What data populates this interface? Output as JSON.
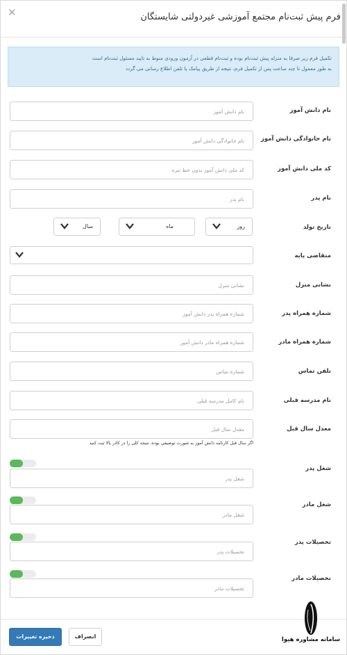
{
  "modal": {
    "title": "فرم پیش ثبت‌نام مجتمع آموزشی غیردولتی شایستگان",
    "close_icon": "close-icon"
  },
  "info": {
    "line1": "تکمیل فرم زیر صرفا به منزله پیش ثبت‌نام بوده و ثبت‌نام قطعی در آزمون ورودی منوط به تایید مسئول ثبت‌نام است",
    "line2": "به طور معمول تا چند ساعت پس از تکمیل فرم، نتیجه از طریق پیامک یا تلفن اطلاع رسانی می گردد"
  },
  "fields": {
    "first_name": {
      "label": "نام دانش آموز",
      "placeholder": "نام دانش آموز"
    },
    "last_name": {
      "label": "نام خانوادگی دانش آموز",
      "placeholder": "نام خانوادگی دانش آموز"
    },
    "national_code": {
      "label": "کد ملی دانش آموز",
      "placeholder": "کد ملی دانش آموز بدون خط تیره"
    },
    "father_name": {
      "label": "نام پدر",
      "placeholder": "نام پدر"
    },
    "birth_date": {
      "label": "تاریخ تولد",
      "day": "روز",
      "month": "ماه",
      "year": "سال"
    },
    "grade": {
      "label": "متقاضی پایه",
      "value": ""
    },
    "address": {
      "label": "نشانی منزل",
      "placeholder": "نشانی منزل"
    },
    "father_mobile": {
      "label": "شماره همراه پدر",
      "placeholder": "شماره همراه پدر دانش آموز"
    },
    "mother_mobile": {
      "label": "شماره همراه مادر",
      "placeholder": "شماره همراه مادر دانش آموز"
    },
    "phone": {
      "label": "تلفن تماس",
      "placeholder": "شماره تماس"
    },
    "previous_school": {
      "label": "نام مدرسه قبلی",
      "placeholder": "نام کامل مدرسه قبلی"
    },
    "previous_gpa": {
      "label": "معدل سال قبل",
      "placeholder": "معدل سال قبل"
    },
    "gpa_hint": "اگر سال قبل کارنامه دانش آموز به صورت توصیفی بوده، نتیجه کلی را در کادر بالا ثبت کنید",
    "father_job": {
      "label": "شغل پدر",
      "placeholder": "شغل پدر",
      "toggle_on": true
    },
    "mother_job": {
      "label": "شغل مادر",
      "placeholder": "شغل مادر",
      "toggle_on": true
    },
    "father_education": {
      "label": "تحصیلات پدر",
      "placeholder": "تحصیلات پدر",
      "toggle_on": true
    },
    "mother_education": {
      "label": "تحصیلات مادر",
      "placeholder": "تحصیلات مادر",
      "toggle_on": true
    }
  },
  "buttons": {
    "save": "ذخیره تغییرات",
    "cancel": "انصراف"
  },
  "watermark": {
    "text": "سامانه مشاوره هیوا"
  },
  "colors": {
    "primary": "#337ab7",
    "toggle_on": "#5cb85c",
    "info_bg": "#d9ecf7",
    "info_text": "#31708f"
  }
}
